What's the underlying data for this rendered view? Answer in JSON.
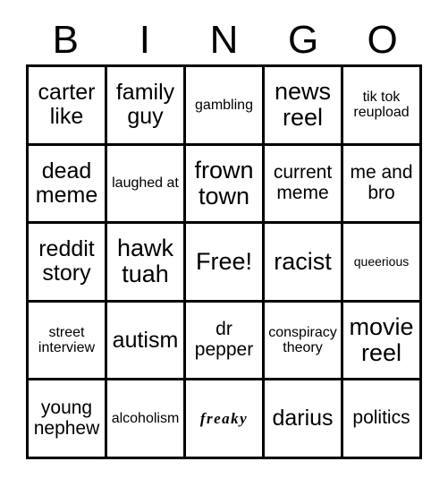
{
  "card": {
    "title": "BINGO",
    "header_letters": [
      "B",
      "I",
      "N",
      "G",
      "O"
    ],
    "rows": [
      [
        {
          "text": "carter like",
          "size": "fs-lg"
        },
        {
          "text": "family guy",
          "size": "fs-lg"
        },
        {
          "text": "gambling",
          "size": "fs-sm"
        },
        {
          "text": "news reel",
          "size": "fs-xl"
        },
        {
          "text": "tik tok reupload",
          "size": "fs-sm"
        }
      ],
      [
        {
          "text": "dead meme",
          "size": "fs-lg"
        },
        {
          "text": "laughed at",
          "size": "fs-sm"
        },
        {
          "text": "frown town",
          "size": "fs-xl"
        },
        {
          "text": "current meme",
          "size": "fs-md"
        },
        {
          "text": "me and bro",
          "size": "fs-md"
        }
      ],
      [
        {
          "text": "reddit story",
          "size": "fs-lg"
        },
        {
          "text": "hawk tuah",
          "size": "fs-xl"
        },
        {
          "text": "Free!",
          "size": "fs-xl"
        },
        {
          "text": "racist",
          "size": "fs-xl"
        },
        {
          "text": "queerious",
          "size": "fs-xs"
        }
      ],
      [
        {
          "text": "street interview",
          "size": "fs-sm"
        },
        {
          "text": "autism",
          "size": "fs-lg"
        },
        {
          "text": "dr pepper",
          "size": "fs-md"
        },
        {
          "text": "conspiracy theory",
          "size": "fs-sm"
        },
        {
          "text": "movie reel",
          "size": "fs-xl"
        }
      ],
      [
        {
          "text": "young nephew",
          "size": "fs-md"
        },
        {
          "text": "alcoholism",
          "size": "fs-sm"
        },
        {
          "text": "freaky",
          "size": "script"
        },
        {
          "text": "darius",
          "size": "fs-lg"
        },
        {
          "text": "politics",
          "size": "fs-md"
        }
      ]
    ]
  }
}
